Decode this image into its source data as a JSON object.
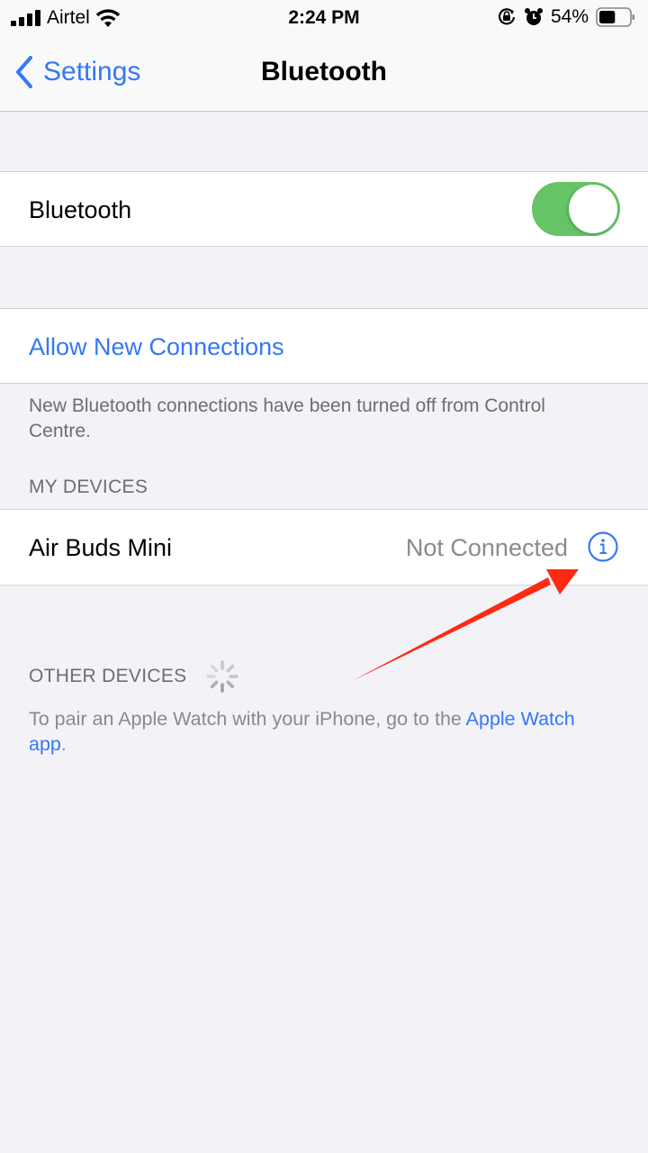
{
  "status_bar": {
    "carrier": "Airtel",
    "time": "2:24 PM",
    "battery_percent": "54%",
    "battery_level": 0.54,
    "icons": [
      "cellular-signal-icon",
      "wifi-icon",
      "orientation-lock-icon",
      "alarm-icon",
      "battery-icon"
    ]
  },
  "nav": {
    "back_label": "Settings",
    "title": "Bluetooth"
  },
  "bluetooth_row": {
    "label": "Bluetooth",
    "toggle_on": true,
    "toggle_color": "#65c466"
  },
  "allow_row": {
    "label": "Allow New Connections",
    "footer": "New Bluetooth connections have been turned off from Control Centre."
  },
  "my_devices": {
    "header": "MY DEVICES",
    "devices": [
      {
        "name": "Air Buds Mini",
        "status": "Not Connected",
        "icon": "info-icon"
      }
    ]
  },
  "other_devices": {
    "header": "OTHER DEVICES",
    "footer_prefix": "To pair an Apple Watch with your iPhone, go to the ",
    "footer_link": "Apple Watch app",
    "footer_suffix": "."
  },
  "annotation": {
    "type": "arrow",
    "color": "#ff2a12",
    "points_to": "info-icon"
  },
  "colors": {
    "accent": "#3478f6",
    "background": "#f2f2f7",
    "secondary_text": "#6d6d72"
  }
}
